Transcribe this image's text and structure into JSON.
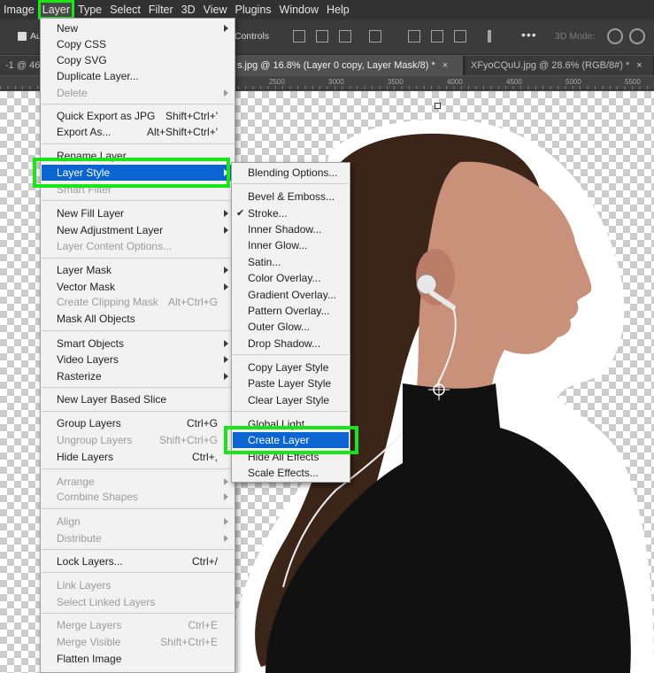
{
  "menubar": {
    "items": [
      "Image",
      "Layer",
      "Type",
      "Select",
      "Filter",
      "3D",
      "View",
      "Plugins",
      "Window",
      "Help"
    ],
    "active_index": 1
  },
  "options_bar": {
    "auto_label": "Au",
    "controls_label": "Controls",
    "mode_3d_label": "3D Mode:",
    "more_label": "•••"
  },
  "tabs": [
    {
      "label": "-1 @ 46."
    },
    {
      "label": "s.jpg @ 16.8% (Layer 0 copy, Layer Mask/8) *",
      "close": "×"
    },
    {
      "label": "XFyoCQuU.jpg @ 28.6% (RGB/8#) *",
      "close": "×"
    }
  ],
  "ruler": {
    "labels": [
      "2500",
      "3000",
      "3500",
      "4000",
      "4500",
      "5000",
      "5500"
    ]
  },
  "layer_menu": {
    "items": [
      {
        "label": "New",
        "submenu": true
      },
      {
        "label": "Copy CSS"
      },
      {
        "label": "Copy SVG"
      },
      {
        "label": "Duplicate Layer..."
      },
      {
        "label": "Delete",
        "submenu": true,
        "disabled": true
      },
      {
        "label": "Quick Export as JPG",
        "shortcut": "Shift+Ctrl+'"
      },
      {
        "label": "Export As...",
        "shortcut": "Alt+Shift+Ctrl+'"
      },
      {
        "label": "Rename Layer..."
      },
      {
        "label": "Layer Style",
        "submenu": true,
        "highlighted": true
      },
      {
        "label": "Smart Filter",
        "disabled": true
      },
      {
        "label": "New Fill Layer",
        "submenu": true
      },
      {
        "label": "New Adjustment Layer",
        "submenu": true
      },
      {
        "label": "Layer Content Options...",
        "disabled": true
      },
      {
        "label": "Layer Mask",
        "submenu": true
      },
      {
        "label": "Vector Mask",
        "submenu": true
      },
      {
        "label": "Create Clipping Mask",
        "shortcut": "Alt+Ctrl+G",
        "disabled": true
      },
      {
        "label": "Mask All Objects"
      },
      {
        "label": "Smart Objects",
        "submenu": true
      },
      {
        "label": "Video Layers",
        "submenu": true
      },
      {
        "label": "Rasterize",
        "submenu": true
      },
      {
        "label": "New Layer Based Slice"
      },
      {
        "label": "Group Layers",
        "shortcut": "Ctrl+G"
      },
      {
        "label": "Ungroup Layers",
        "shortcut": "Shift+Ctrl+G",
        "disabled": true
      },
      {
        "label": "Hide Layers",
        "shortcut": "Ctrl+,"
      },
      {
        "label": "Arrange",
        "submenu": true,
        "disabled": true
      },
      {
        "label": "Combine Shapes",
        "submenu": true,
        "disabled": true
      },
      {
        "label": "Align",
        "submenu": true,
        "disabled": true
      },
      {
        "label": "Distribute",
        "submenu": true,
        "disabled": true
      },
      {
        "label": "Lock Layers...",
        "shortcut": "Ctrl+/"
      },
      {
        "label": "Link Layers",
        "disabled": true
      },
      {
        "label": "Select Linked Layers",
        "disabled": true
      },
      {
        "label": "Merge Layers",
        "shortcut": "Ctrl+E",
        "disabled": true
      },
      {
        "label": "Merge Visible",
        "shortcut": "Shift+Ctrl+E",
        "disabled": true
      },
      {
        "label": "Flatten Image"
      }
    ]
  },
  "layer_style_menu": {
    "items": [
      {
        "label": "Blending Options..."
      },
      {
        "label": "Bevel & Emboss..."
      },
      {
        "label": "Stroke...",
        "checked": true,
        "check": "✔"
      },
      {
        "label": "Inner Shadow..."
      },
      {
        "label": "Inner Glow..."
      },
      {
        "label": "Satin..."
      },
      {
        "label": "Color Overlay..."
      },
      {
        "label": "Gradient Overlay..."
      },
      {
        "label": "Pattern Overlay..."
      },
      {
        "label": "Outer Glow..."
      },
      {
        "label": "Drop Shadow..."
      },
      {
        "label": "Copy Layer Style"
      },
      {
        "label": "Paste Layer Style"
      },
      {
        "label": "Clear Layer Style"
      },
      {
        "label": "Global Light..."
      },
      {
        "label": "Create Layer",
        "highlighted": true
      },
      {
        "label": "Hide All Effects"
      },
      {
        "label": "Scale Effects..."
      }
    ]
  },
  "colors": {
    "highlight": "#0a64d2",
    "annotation_box": "#19e619",
    "menu_bg": "#f2f2f2",
    "app_bar": "#323232"
  }
}
